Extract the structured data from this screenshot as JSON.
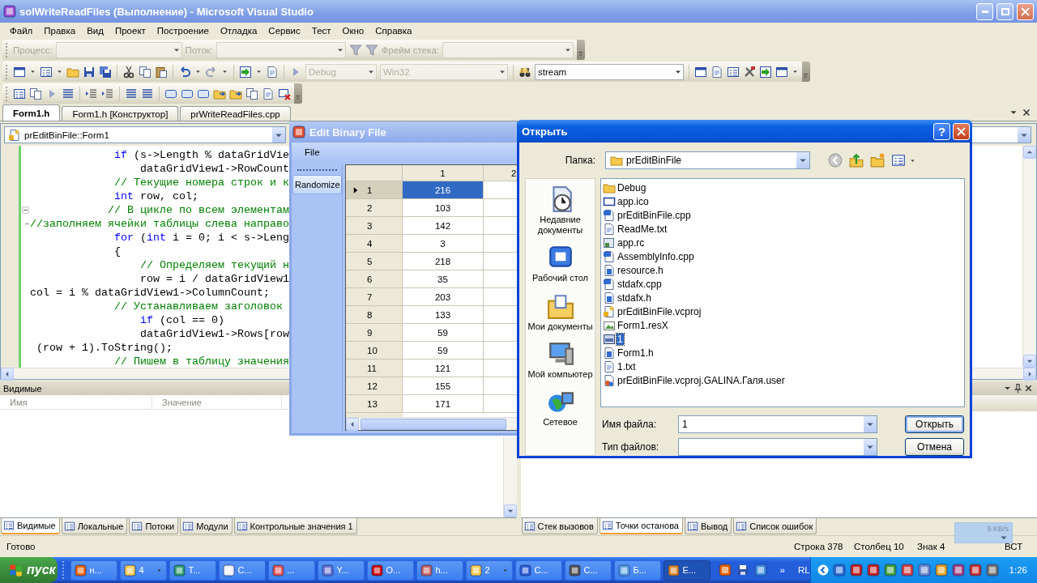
{
  "window": {
    "title": "solWriteReadFiles (Выполнение) - Microsoft Visual Studio"
  },
  "menu": [
    "Файл",
    "Правка",
    "Вид",
    "Проект",
    "Построение",
    "Отладка",
    "Сервис",
    "Тест",
    "Окно",
    "Справка"
  ],
  "debug_toolbar": {
    "fields": [
      {
        "label": "Процесс:",
        "disabled": true
      },
      {
        "label": "Поток:",
        "disabled": true
      },
      {
        "label": "Фрейм стека:",
        "disabled": true
      }
    ]
  },
  "standard_toolbar": {
    "configuration": {
      "value": "Debug",
      "disabled": true
    },
    "platform": {
      "value": "Win32",
      "disabled": true
    },
    "find": {
      "value": "stream",
      "disabled": false
    }
  },
  "doc_tabs": [
    {
      "label": "Form1.h",
      "selected": true
    },
    {
      "label": "Form1.h [Конструктор]",
      "selected": false
    },
    {
      "label": "prWriteReadFiles.cpp",
      "selected": false
    }
  ],
  "editor": {
    "scope": "prEditBinFile::Form1",
    "lines": [
      {
        "kind": "code",
        "segments": [
          {
            "kind": "keyword",
            "text": "             if"
          },
          {
            "kind": "plain",
            "text": " (s->Length % dataGridVie"
          }
        ]
      },
      {
        "kind": "code",
        "segments": [
          {
            "kind": "plain",
            "text": "                 dataGridView1->RowCount"
          }
        ]
      },
      {
        "kind": "code",
        "segments": [
          {
            "kind": "comment",
            "text": "             // Текущие номера строк и к"
          }
        ]
      },
      {
        "kind": "code",
        "segments": [
          {
            "kind": "keyword",
            "text": "             int"
          },
          {
            "kind": "plain",
            "text": " row, col;"
          }
        ]
      },
      {
        "kind": "fold_start",
        "segments": [
          {
            "kind": "comment",
            "text": "            // В цикле по всем элементам"
          }
        ]
      },
      {
        "kind": "fold_end",
        "segments": [
          {
            "kind": "comment",
            "text": "//заполняем ячейки таблицы слева направо"
          }
        ]
      },
      {
        "kind": "code",
        "segments": [
          {
            "kind": "keyword",
            "text": "             for"
          },
          {
            "kind": "plain",
            "text": " ("
          },
          {
            "kind": "keyword",
            "text": "int"
          },
          {
            "kind": "plain",
            "text": " i = 0; i < s->Leng"
          }
        ]
      },
      {
        "kind": "code",
        "segments": [
          {
            "kind": "plain",
            "text": "             {"
          }
        ]
      },
      {
        "kind": "code",
        "segments": [
          {
            "kind": "comment",
            "text": "                 // Определяем текущий н"
          }
        ]
      },
      {
        "kind": "code",
        "segments": [
          {
            "kind": "plain",
            "text": "                 row = i / dataGridView1"
          }
        ]
      },
      {
        "kind": "code",
        "segments": [
          {
            "kind": "plain",
            "text": "col = i % dataGridView1->ColumnCount;"
          }
        ]
      },
      {
        "kind": "code",
        "segments": [
          {
            "kind": "comment",
            "text": "             // Устанавливаем заголовок"
          }
        ]
      },
      {
        "kind": "code",
        "segments": [
          {
            "kind": "keyword",
            "text": "                 if"
          },
          {
            "kind": "plain",
            "text": " (col == 0)"
          }
        ]
      },
      {
        "kind": "code",
        "segments": [
          {
            "kind": "plain",
            "text": "                 dataGridView1->Rows[row"
          }
        ]
      },
      {
        "kind": "code",
        "segments": [
          {
            "kind": "plain",
            "text": " (row + 1).ToString();"
          }
        ]
      },
      {
        "kind": "code",
        "segments": [
          {
            "kind": "comment",
            "text": "             // Пишем в таблицу значения"
          }
        ]
      }
    ]
  },
  "edit_window": {
    "title": "Edit Binary File",
    "menu": [
      "File"
    ],
    "tool_button": "Randomize",
    "grid": {
      "columns": [
        "1",
        "2"
      ],
      "rows": [
        {
          "header": "1",
          "value": "216",
          "current": true,
          "selected": true
        },
        {
          "header": "2",
          "value": "103",
          "current": false,
          "selected": false
        },
        {
          "header": "3",
          "value": "142",
          "current": false,
          "selected": false
        },
        {
          "header": "4",
          "value": "3",
          "current": false,
          "selected": false
        },
        {
          "header": "5",
          "value": "218",
          "current": false,
          "selected": false
        },
        {
          "header": "6",
          "value": "35",
          "current": false,
          "selected": false
        },
        {
          "header": "7",
          "value": "203",
          "current": false,
          "selected": false
        },
        {
          "header": "8",
          "value": "133",
          "current": false,
          "selected": false
        },
        {
          "header": "9",
          "value": "59",
          "current": false,
          "selected": false
        },
        {
          "header": "10",
          "value": "59",
          "current": false,
          "selected": false
        },
        {
          "header": "11",
          "value": "121",
          "current": false,
          "selected": false
        },
        {
          "header": "12",
          "value": "155",
          "current": false,
          "selected": false
        },
        {
          "header": "13",
          "value": "171",
          "current": false,
          "selected": false
        }
      ]
    }
  },
  "open_dialog": {
    "title": "Открыть",
    "help": "?",
    "folder_label": "Папка:",
    "folder": "prEditBinFile",
    "places": [
      {
        "kind": "recent",
        "label": "Недавние документы"
      },
      {
        "kind": "desktop",
        "label": "Рабочий стол"
      },
      {
        "kind": "documents",
        "label": "Мои документы"
      },
      {
        "kind": "computer",
        "label": "Мой компьютер"
      },
      {
        "kind": "network",
        "label": "Сетевое"
      }
    ],
    "files": [
      {
        "kind": "folder",
        "name": "Debug",
        "selected": false
      },
      {
        "kind": "ico",
        "name": "app.ico",
        "selected": false
      },
      {
        "kind": "cpp",
        "name": "prEditBinFile.cpp",
        "selected": false
      },
      {
        "kind": "txt",
        "name": "ReadMe.txt",
        "selected": false
      },
      {
        "kind": "rc",
        "name": "app.rc",
        "selected": false
      },
      {
        "kind": "cpp",
        "name": "AssemblyInfo.cpp",
        "selected": false
      },
      {
        "kind": "h",
        "name": "resource.h",
        "selected": false
      },
      {
        "kind": "cpp",
        "name": "stdafx.cpp",
        "selected": false
      },
      {
        "kind": "h",
        "name": "stdafx.h",
        "selected": false
      },
      {
        "kind": "project",
        "name": "prEditBinFile.vcproj",
        "selected": false
      },
      {
        "kind": "resx",
        "name": "Form1.resX",
        "selected": false
      },
      {
        "kind": "binary",
        "name": "1",
        "selected": true
      },
      {
        "kind": "h",
        "name": "Form1.h",
        "selected": false
      },
      {
        "kind": "txt",
        "name": "1.txt",
        "selected": false
      },
      {
        "kind": "user",
        "name": "prEditBinFile.vcproj.GALINA.Галя.user",
        "selected": false
      }
    ],
    "file_name": {
      "label": "Имя файла:",
      "value": "1"
    },
    "file_type": {
      "label": "Тип файлов:"
    },
    "buttons": [
      {
        "label": "Открыть",
        "default": true
      },
      {
        "label": "Отмена",
        "default": false
      }
    ]
  },
  "watch_panel": {
    "title": "Видимые",
    "columns": [
      "Имя",
      "Значение"
    ]
  },
  "left_tabs": [
    {
      "label": "Видимые",
      "selected": true
    },
    {
      "label": "Локальные",
      "selected": false
    },
    {
      "label": "Потоки",
      "selected": false
    },
    {
      "label": "Модули",
      "selected": false
    },
    {
      "label": "Контрольные значения 1",
      "selected": false
    }
  ],
  "right_tabs": [
    {
      "label": "Стек вызовов",
      "selected": false
    },
    {
      "label": "Точки останова",
      "selected": true
    },
    {
      "label": "Вывод",
      "selected": false
    },
    {
      "label": "Список ошибок",
      "selected": false
    }
  ],
  "status_bar": {
    "text": "Готово",
    "line": "Строка 378",
    "column": "Столбец 10",
    "char": "Знак 4",
    "mode": "ВСТ"
  },
  "network_meter": {
    "speed": "5 KB/s"
  },
  "taskbar": {
    "start": "пуск",
    "tasks": [
      {
        "label": "н...",
        "grouped": false,
        "selected": false
      },
      {
        "label": "4",
        "grouped": true,
        "selected": false
      },
      {
        "label": "Т...",
        "grouped": false,
        "selected": false
      },
      {
        "label": "С...",
        "grouped": false,
        "selected": false
      },
      {
        "label": "...",
        "grouped": false,
        "selected": false
      },
      {
        "label": "Y...",
        "grouped": false,
        "selected": false
      },
      {
        "label": "О...",
        "grouped": false,
        "selected": false
      },
      {
        "label": "h...",
        "grouped": false,
        "selected": false
      },
      {
        "label": "2",
        "grouped": true,
        "selected": false
      },
      {
        "label": "С...",
        "grouped": false,
        "selected": false
      },
      {
        "label": "С...",
        "grouped": false,
        "selected": false
      },
      {
        "label": "Б...",
        "grouped": false,
        "selected": false
      },
      {
        "label": "E...",
        "grouped": false,
        "selected": true
      }
    ],
    "more": "»",
    "language": "RL",
    "clock": "1:26"
  }
}
